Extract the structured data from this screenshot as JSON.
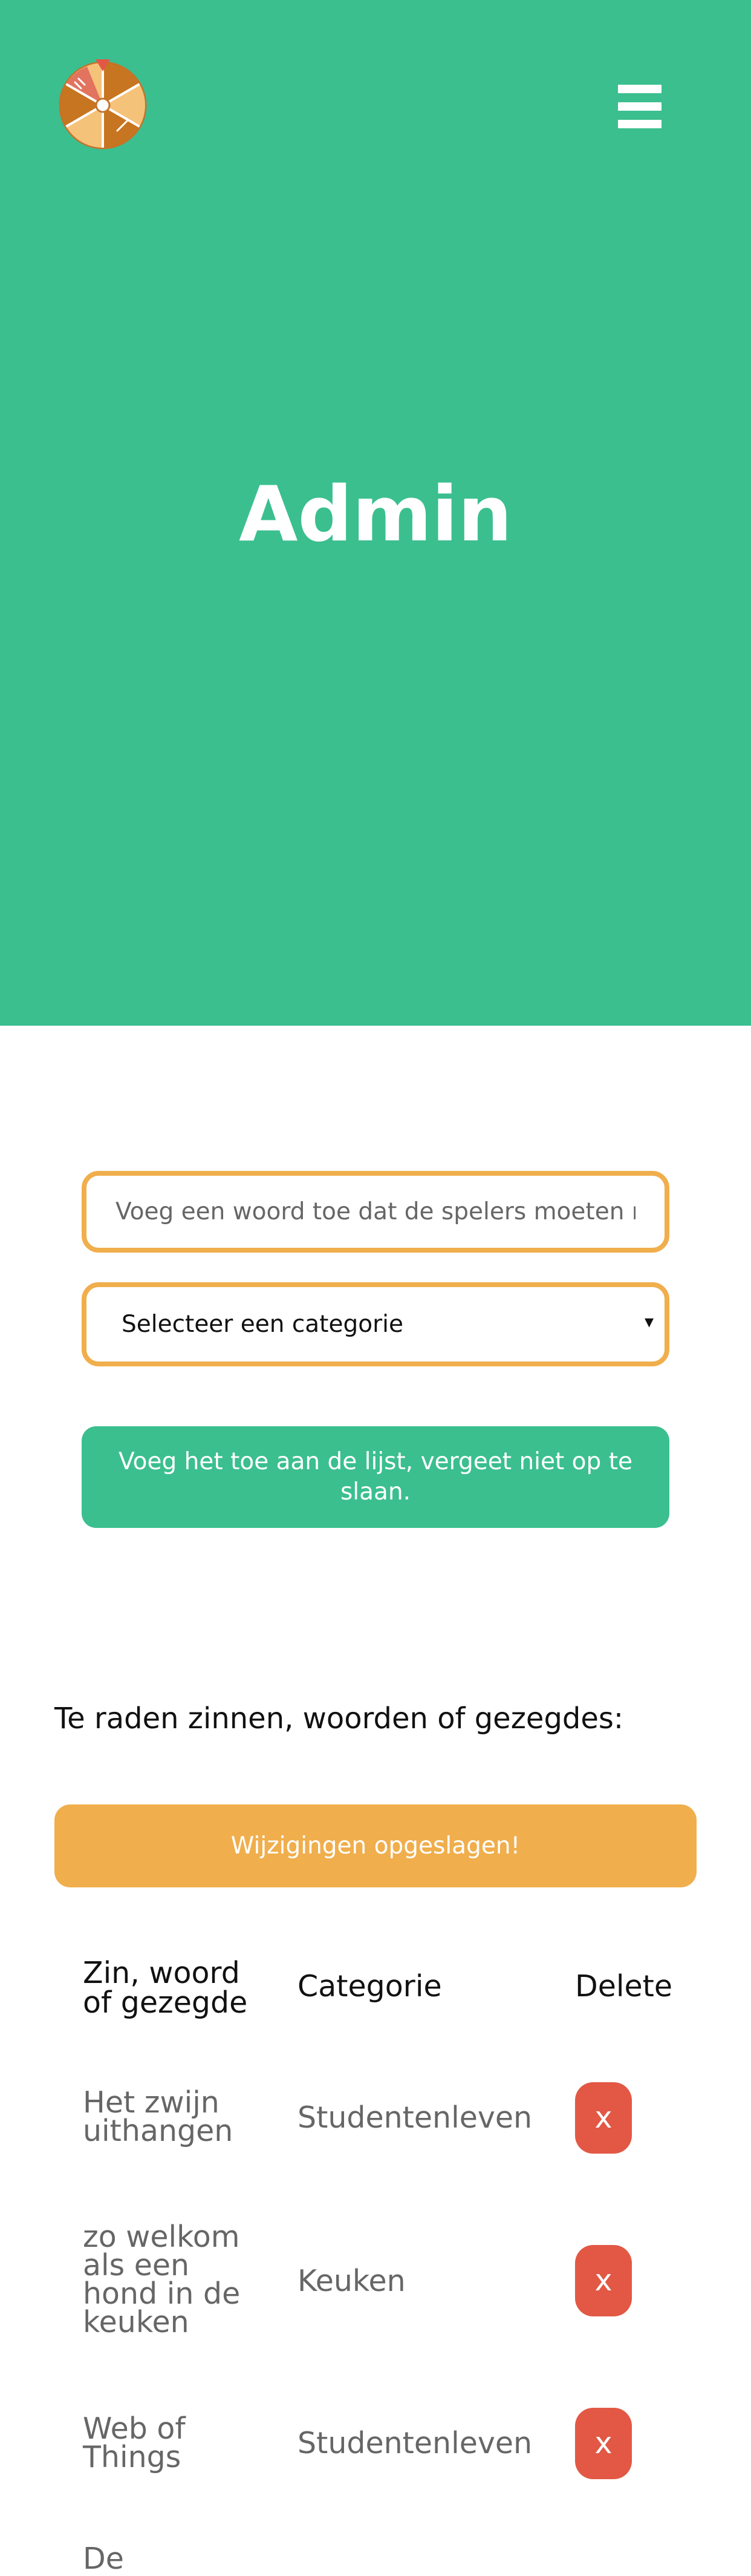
{
  "header": {
    "logo_icon": "prize-wheel-icon",
    "menu_icon": "hamburger-menu-icon",
    "title": "Admin",
    "background": "#3bbf8f"
  },
  "form": {
    "word_placeholder": "Voeg een woord toe dat de spelers moeten raden",
    "category_selected": "Selecteer een categorie",
    "category_arrow": "▾",
    "add_button_label": "Voeg het toe aan de lijst, vergeet niet op te slaan.",
    "accent": "#f0ae4c"
  },
  "list": {
    "heading": "Te raden zinnen, woorden of gezegdes:",
    "saved_message": "Wijzigingen opgeslagen!",
    "columns": [
      "Zin, woord of gezegde",
      "Categorie",
      "Delete"
    ],
    "rows": [
      {
        "word": "Het zwijn uithangen",
        "category": "Studentenleven",
        "delete": "x"
      },
      {
        "word": "zo welkom als een hond in de keuken",
        "category": "Keuken",
        "delete": "x"
      },
      {
        "word": "Web of Things",
        "category": "Studentenleven",
        "delete": "x"
      },
      {
        "word": "De",
        "category": "",
        "delete": ""
      }
    ],
    "delete_color": "#e25845"
  }
}
